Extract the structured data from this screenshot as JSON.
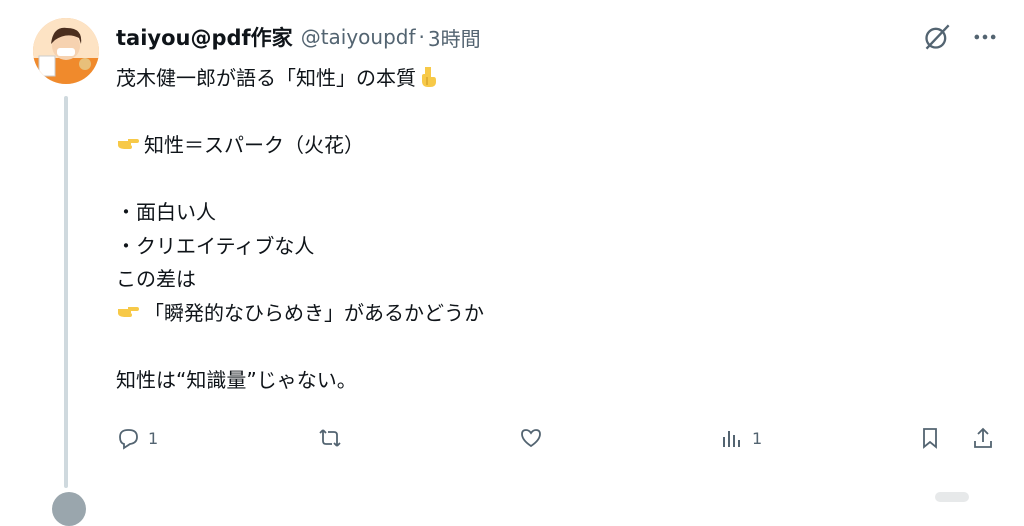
{
  "post": {
    "display_name": "taiyou@pdf作家",
    "handle": "@taiyoupdf",
    "separator": "·",
    "time": "3時間",
    "lines": [
      "茂木健一郎が語る「知性」の本質",
      "",
      "知性＝スパーク（火花）",
      "",
      "・面白い人",
      "・クリエイティブな人",
      "この差は",
      "「瞬発的なひらめき」があるかどうか",
      "",
      "知性は“知識量”じゃない。"
    ],
    "emoji": {
      "line0_suffix": "pointing-down-hand-icon",
      "line2_prefix": "pointing-right-hand-icon",
      "line7_prefix": "pointing-right-hand-icon"
    }
  },
  "actions": {
    "reply_count": "1",
    "retweet_count": "",
    "like_count": "",
    "views_count": "1"
  },
  "icons": {
    "grok": "grok-icon",
    "more": "more-icon",
    "reply": "reply-icon",
    "retweet": "retweet-icon",
    "like": "heart-icon",
    "views": "views-icon",
    "bookmark": "bookmark-icon",
    "share": "share-icon"
  },
  "colors": {
    "text": "#0f1419",
    "muted": "#536471",
    "thread_line": "#cfd9de",
    "emoji_yellow": "#f7c948"
  }
}
